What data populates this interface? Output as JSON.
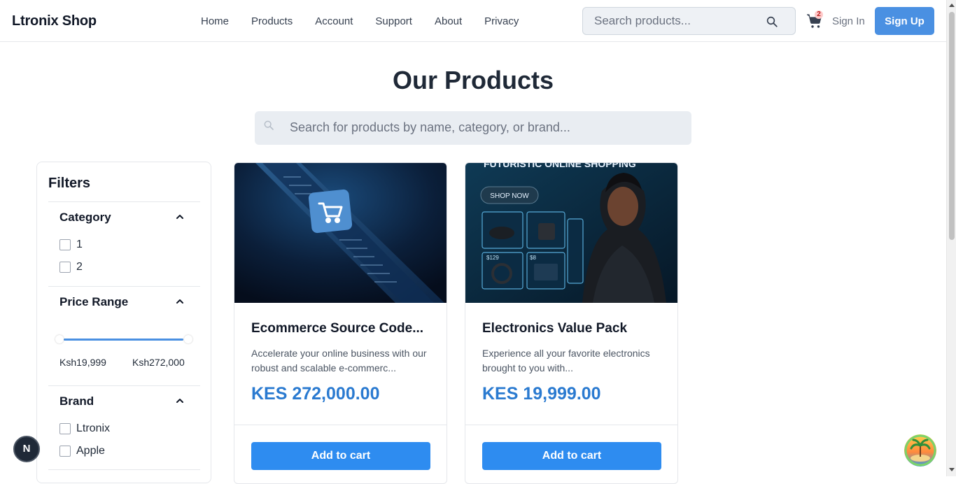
{
  "header": {
    "logo": "Ltronix Shop",
    "nav": [
      "Home",
      "Products",
      "Account",
      "Support",
      "About",
      "Privacy"
    ],
    "search_placeholder": "Search products...",
    "cart_count": "2",
    "signin_label": "Sign In",
    "signup_label": "Sign Up"
  },
  "main": {
    "title": "Our Products",
    "search_placeholder": "Search for products by name, category, or brand..."
  },
  "filters": {
    "title": "Filters",
    "category": {
      "title": "Category",
      "options": [
        "1",
        "2"
      ]
    },
    "price": {
      "title": "Price Range",
      "min_label": "Ksh19,999",
      "max_label": "Ksh272,000"
    },
    "brand": {
      "title": "Brand",
      "options": [
        "Ltronix",
        "Apple"
      ]
    }
  },
  "products": [
    {
      "name": "Ecommerce Source Code...",
      "description": "Accelerate your online business with our robust and scalable e-commerc...",
      "price": "KES 272,000.00",
      "add_label": "Add to cart"
    },
    {
      "name": "Electronics Value Pack",
      "description": "Experience all your favorite electronics brought to you with...",
      "price": "KES 19,999.00",
      "add_label": "Add to cart",
      "image_text": {
        "headline": "FUTURISTIC ONLINE SHOPPING",
        "cta": "SHOP NOW",
        "price_a": "$129",
        "price_b": "$8"
      }
    }
  ],
  "floating": {
    "next_badge": "N"
  },
  "colors": {
    "accent": "#4a90e2",
    "button": "#2e8cf0",
    "price": "#2a7ad0"
  }
}
